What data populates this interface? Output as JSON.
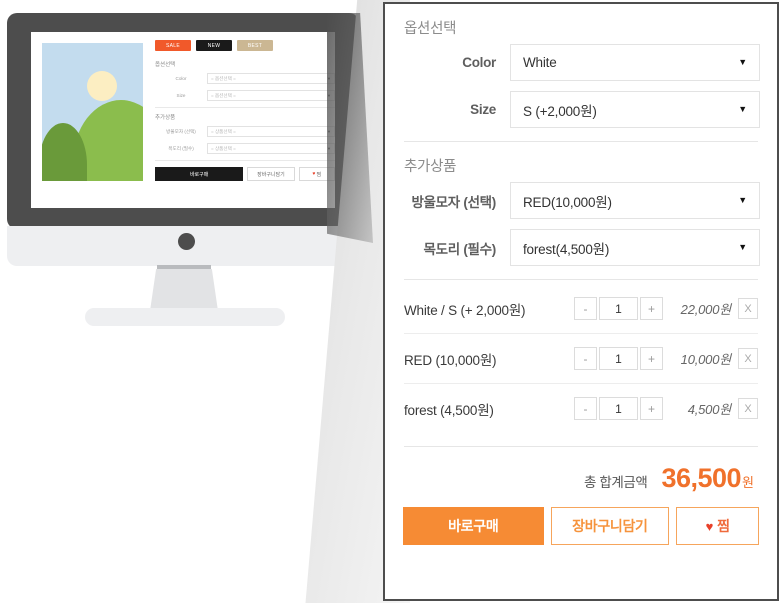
{
  "monitor": {
    "badges": [
      {
        "label": "SALE",
        "color": "#f1592a"
      },
      {
        "label": "NEW",
        "color": "#1a1a1a"
      },
      {
        "label": "BEST",
        "color": "#cbb793"
      }
    ],
    "option_section_title": "옵션선택",
    "addon_section_title": "추가상품",
    "rows": [
      {
        "label": "Color",
        "value": "= 옵션선택 ="
      },
      {
        "label": "Size",
        "value": "= 옵션선택 ="
      },
      {
        "label": "방울모자 (선택)",
        "value": "= 상품선택 ="
      },
      {
        "label": "목도리 (필수)",
        "value": "= 상품선택 ="
      }
    ],
    "buttons": {
      "buy": "바로구매",
      "cart": "장바구니담기",
      "wish": "찜",
      "wish_icon": "heart-icon"
    }
  },
  "panel": {
    "option_section": {
      "title": "옵션선택",
      "rows": [
        {
          "label": "Color",
          "value": "White"
        },
        {
          "label": "Size",
          "value": "S (+2,000원)"
        }
      ]
    },
    "addon_section": {
      "title": "추가상품",
      "rows": [
        {
          "label": "방울모자 (선택)",
          "value": "RED(10,000원)"
        },
        {
          "label": "목도리 (필수)",
          "value": "forest(4,500원)"
        }
      ]
    },
    "cart_items": [
      {
        "name": "White / S (+ 2,000원)",
        "minus": "-",
        "qty": "1",
        "plus": "+",
        "price": "22,000원",
        "remove": "X"
      },
      {
        "name": "RED (10,000원)",
        "minus": "-",
        "qty": "1",
        "plus": "+",
        "price": "10,000원",
        "remove": "X"
      },
      {
        "name": "forest (4,500원)",
        "minus": "-",
        "qty": "1",
        "plus": "+",
        "price": "4,500원",
        "remove": "X"
      }
    ],
    "total": {
      "label": "총 합계금액",
      "amount": "36,500",
      "unit": "원"
    },
    "actions": {
      "buy": "바로구매",
      "cart": "장바구니담기",
      "wish": "찜",
      "wish_icon": "heart-icon"
    },
    "caret_glyph": "▼"
  },
  "colors": {
    "accent_orange": "#f68b34",
    "price_orange": "#f0712b",
    "heart_red": "#e8402a",
    "panel_border": "#4d4d4d"
  }
}
